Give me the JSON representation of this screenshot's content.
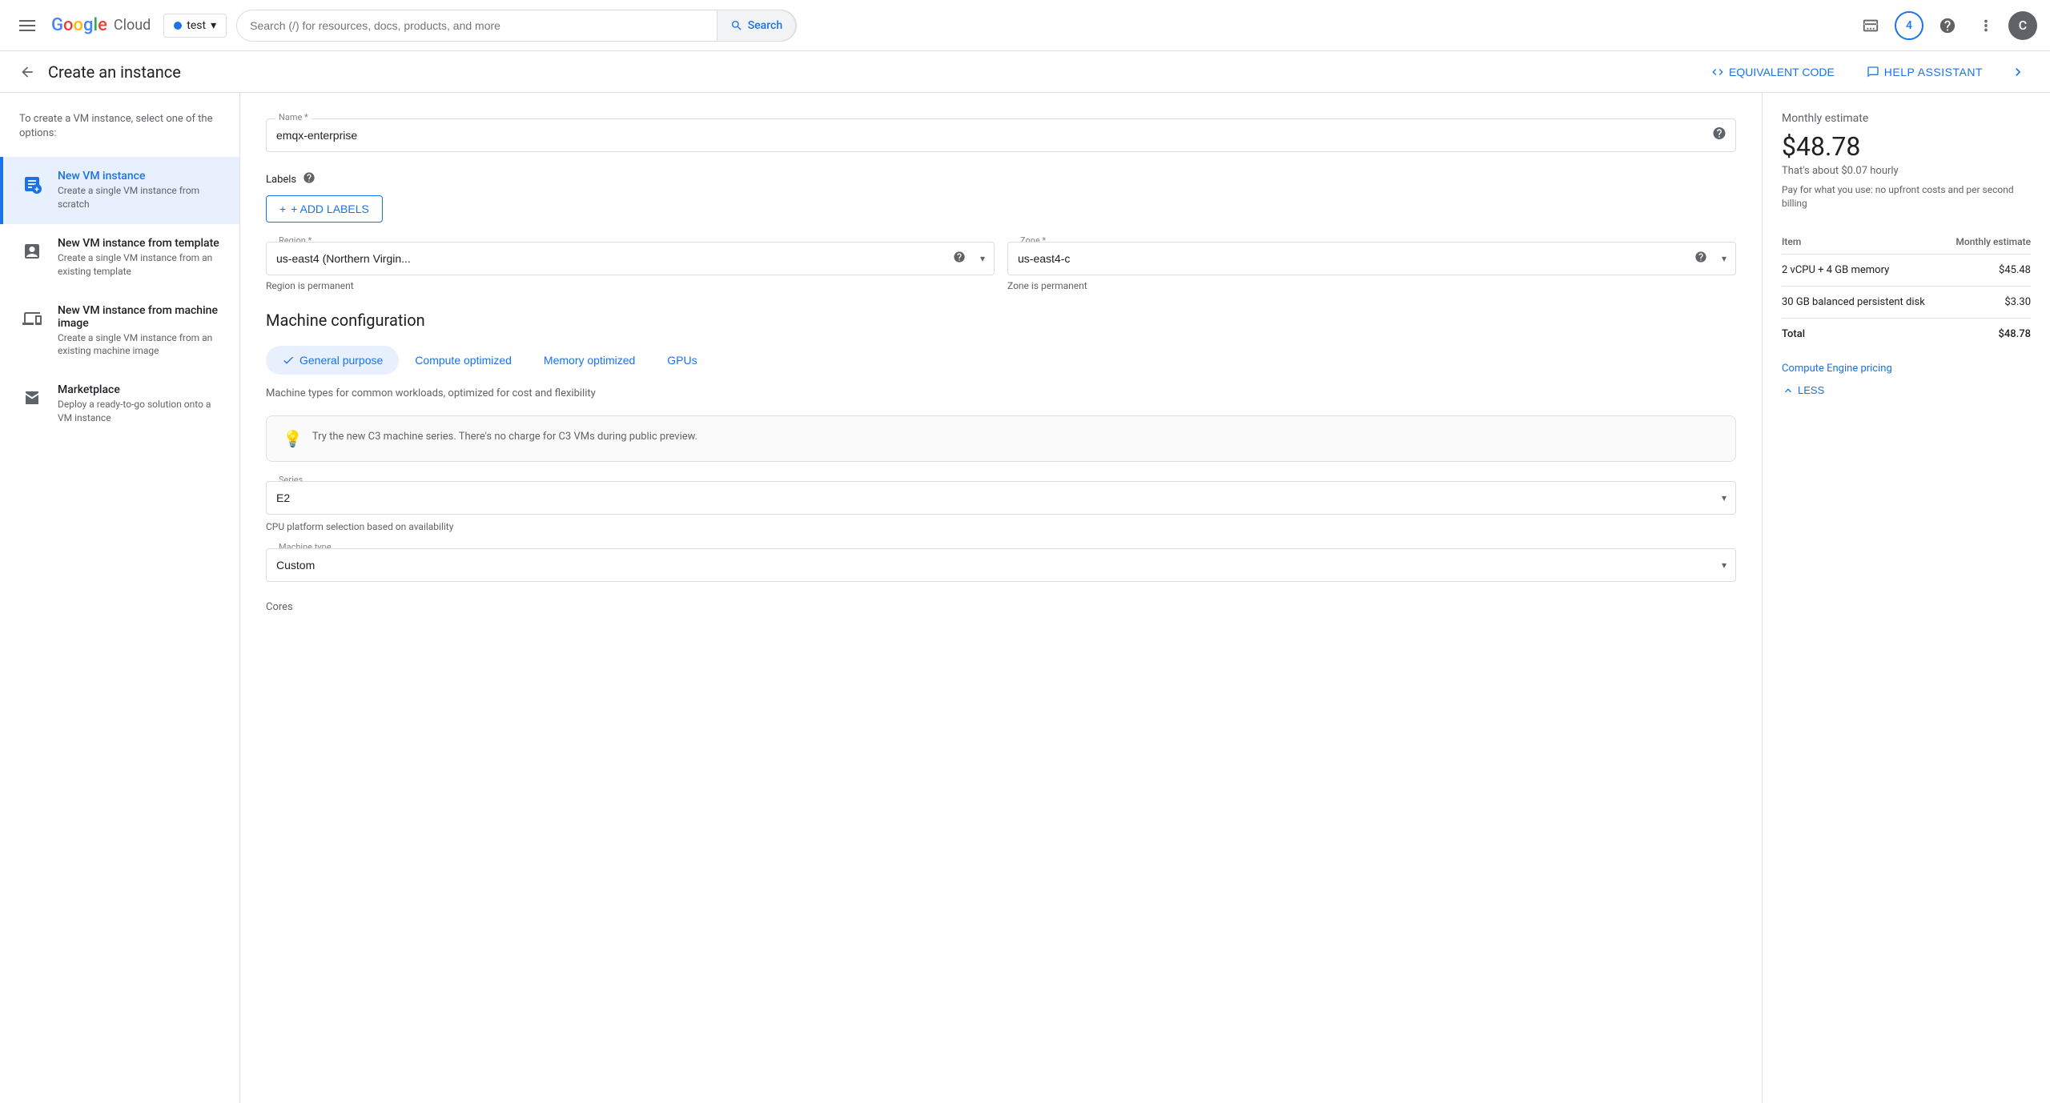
{
  "nav": {
    "hamburger_label": "Menu",
    "logo": {
      "G": "G",
      "o1": "o",
      "o2": "o",
      "g": "g",
      "l": "l",
      "e": "e",
      "cloud": "Cloud"
    },
    "project": {
      "name": "test",
      "arrow": "▾"
    },
    "search": {
      "placeholder": "Search (/) for resources, docs, products, and more",
      "button_label": "Search"
    },
    "notification_count": "4",
    "avatar_letter": "C"
  },
  "sub_header": {
    "back_label": "←",
    "page_title": "Create an instance",
    "equiv_code_label": "EQUIVALENT CODE",
    "help_assistant_label": "HELP ASSISTANT"
  },
  "sidebar": {
    "intro": "To create a VM instance, select one of the options:",
    "items": [
      {
        "id": "new-vm",
        "title": "New VM instance",
        "desc": "Create a single VM instance from scratch",
        "active": true
      },
      {
        "id": "new-vm-template",
        "title": "New VM instance from template",
        "desc": "Create a single VM instance from an existing template",
        "active": false
      },
      {
        "id": "new-vm-image",
        "title": "New VM instance from machine image",
        "desc": "Create a single VM instance from an existing machine image",
        "active": false
      },
      {
        "id": "marketplace",
        "title": "Marketplace",
        "desc": "Deploy a ready-to-go solution onto a VM instance",
        "active": false
      }
    ]
  },
  "form": {
    "name_label": "Name *",
    "name_value": "emqx-enterprise",
    "labels_label": "Labels",
    "add_labels_btn": "+ ADD LABELS",
    "region_label": "Region *",
    "region_value": "us-east4 (Northern Virgin...",
    "region_note": "Region is permanent",
    "zone_label": "Zone *",
    "zone_value": "us-east4-c",
    "zone_note": "Zone is permanent",
    "machine_config_title": "Machine configuration",
    "tabs": [
      {
        "id": "general",
        "label": "General purpose",
        "active": true
      },
      {
        "id": "compute",
        "label": "Compute optimized",
        "active": false
      },
      {
        "id": "memory",
        "label": "Memory optimized",
        "active": false
      },
      {
        "id": "gpus",
        "label": "GPUs",
        "active": false
      }
    ],
    "tab_desc": "Machine types for common workloads, optimized for cost and flexibility",
    "info_box": "Try the new C3 machine series. There's no charge for C3 VMs during public preview.",
    "series_label": "Series",
    "series_value": "E2",
    "cpu_note": "CPU platform selection based on availability",
    "machine_type_label": "Machine type",
    "machine_type_value": "Custom",
    "cores_label": "Cores"
  },
  "pricing": {
    "title": "Monthly estimate",
    "amount": "$48.78",
    "hourly": "That's about $0.07 hourly",
    "note": "Pay for what you use: no upfront costs and per second billing",
    "table": {
      "headers": [
        "Item",
        "Monthly estimate"
      ],
      "rows": [
        {
          "item": "2 vCPU + 4 GB memory",
          "cost": "$45.48"
        },
        {
          "item": "30 GB balanced persistent disk",
          "cost": "$3.30"
        }
      ],
      "total_label": "Total",
      "total_cost": "$48.78"
    },
    "link": "Compute Engine pricing",
    "less_btn": "LESS"
  }
}
